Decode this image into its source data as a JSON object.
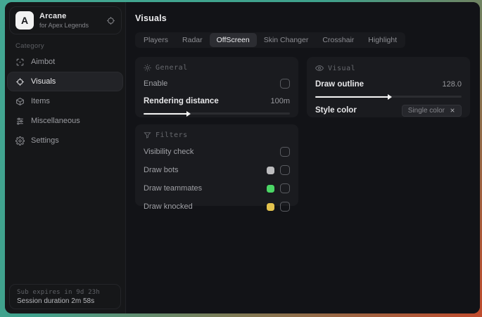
{
  "app": {
    "logo_letter": "A",
    "name": "Arcane",
    "subtitle": "for Apex Legends"
  },
  "sidebar": {
    "category_label": "Category",
    "items": [
      {
        "label": "Aimbot"
      },
      {
        "label": "Visuals"
      },
      {
        "label": "Items"
      },
      {
        "label": "Miscellaneous"
      },
      {
        "label": "Settings"
      }
    ],
    "footer": {
      "line1": "Sub expires in 9d 23h",
      "line2": "Session duration 2m 58s"
    }
  },
  "main": {
    "title": "Visuals",
    "tabs": [
      {
        "label": "Players",
        "selected": false
      },
      {
        "label": "Radar",
        "selected": false
      },
      {
        "label": "OffScreen",
        "selected": true
      },
      {
        "label": "Skin Changer",
        "selected": false
      },
      {
        "label": "Crosshair",
        "selected": false
      },
      {
        "label": "Highlight",
        "selected": false
      }
    ],
    "general": {
      "title": "General",
      "enable_label": "Enable",
      "enable_checked": false,
      "rendering_distance_label": "Rendering distance",
      "rendering_distance_value": "100m",
      "rendering_distance_percent": 30
    },
    "visual": {
      "title": "Visual",
      "draw_outline_label": "Draw outline",
      "draw_outline_value": "128.0",
      "draw_outline_percent": 50,
      "style_color_label": "Style color",
      "style_color_value": "Single color"
    },
    "filters": {
      "title": "Filters",
      "rows": [
        {
          "label": "Visibility check",
          "swatch": null,
          "checked": false
        },
        {
          "label": "Draw bots",
          "swatch": "#bcbcbe",
          "checked": false
        },
        {
          "label": "Draw teammates",
          "swatch": "#4bd665",
          "checked": false
        },
        {
          "label": "Draw knocked",
          "swatch": "#e3c24d",
          "checked": false
        }
      ]
    }
  },
  "colors": {
    "desktop_teal": "#41a68f",
    "desktop_red": "#c04b2d",
    "panel_bg": "#1a1b1f",
    "swatch_gray": "#bcbcbe",
    "swatch_green": "#4bd665",
    "swatch_yellow": "#e3c24d"
  }
}
